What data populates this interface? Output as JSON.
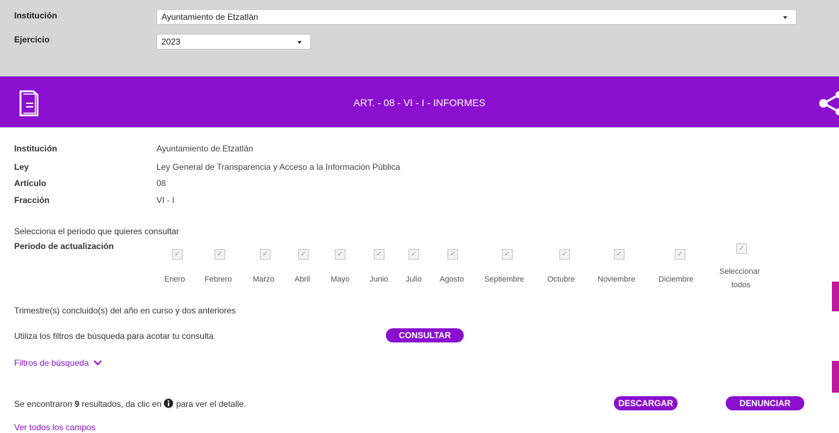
{
  "filters": {
    "institucion_label": "Institución",
    "institucion_value": "Ayuntamiento de Etzatlán",
    "ejercicio_label": "Ejercicio",
    "ejercicio_value": "2023"
  },
  "banner": {
    "title": "ART. - 08 - VI - I - INFORMES",
    "color": "#8a0fcf"
  },
  "info": [
    {
      "label": "Institución",
      "value": "Ayuntamiento de Etzatlán"
    },
    {
      "label": "Ley",
      "value": "Ley General de Transparencia y Acceso a la Información Pública"
    },
    {
      "label": "Artículo",
      "value": "08"
    },
    {
      "label": "Fracción",
      "value": "VI - I"
    }
  ],
  "periodo": {
    "prompt": "Selecciona el periodo que quieres consultar",
    "label": "Periodo de actualización",
    "months": [
      "Enero",
      "Febrero",
      "Marzo",
      "Abril",
      "Mayo",
      "Junio",
      "Julio",
      "Agosto",
      "Septiembre",
      "Octubre",
      "Noviembre",
      "Diciembre"
    ],
    "select_all_line1": "Seleccionar",
    "select_all_line2": "todos",
    "check_glyph": "✓"
  },
  "trimestre_text": "Trimestre(s) concluido(s) del año en curso y dos anteriores",
  "filtros_text": "Utiliza los filtros de búsqueda para acotar tu consulta",
  "consultar_label": "CONSULTAR",
  "filtros_link": "Filtros de búsqueda",
  "results": {
    "prefix": "Se encontraron ",
    "count": "9",
    "middle": " resultados, da clic en ",
    "suffix": " para ver el detalle."
  },
  "descargar_label": "DESCARGAR",
  "denunciar_label": "DENUNCIAR",
  "ver_todos": "Ver todos los campos",
  "colors": {
    "accent": "#8a0fcf",
    "side_tab": "#c0189a",
    "top_background": "#d6d6d6"
  }
}
